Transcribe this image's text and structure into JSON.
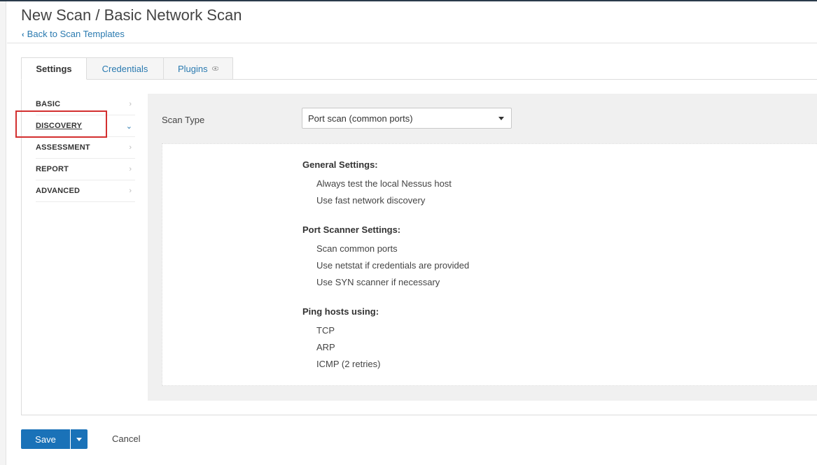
{
  "header": {
    "title": "New Scan / Basic Network Scan",
    "back_link": "Back to Scan Templates"
  },
  "tabs": [
    {
      "label": "Settings",
      "active": true
    },
    {
      "label": "Credentials",
      "active": false
    },
    {
      "label": "Plugins",
      "active": false,
      "icon": "eye-icon"
    }
  ],
  "sidebar": {
    "items": [
      {
        "label": "BASIC",
        "active": false
      },
      {
        "label": "DISCOVERY",
        "active": true
      },
      {
        "label": "ASSESSMENT",
        "active": false
      },
      {
        "label": "REPORT",
        "active": false
      },
      {
        "label": "ADVANCED",
        "active": false
      }
    ]
  },
  "form": {
    "scan_type_label": "Scan Type",
    "scan_type_value": "Port scan (common ports)"
  },
  "summary": {
    "sections": [
      {
        "heading": "General Settings:",
        "items": [
          "Always test the local Nessus host",
          "Use fast network discovery"
        ]
      },
      {
        "heading": "Port Scanner Settings:",
        "items": [
          "Scan common ports",
          "Use netstat if credentials are provided",
          "Use SYN scanner if necessary"
        ]
      },
      {
        "heading": "Ping hosts using:",
        "items": [
          "TCP",
          "ARP",
          "ICMP (2 retries)"
        ]
      }
    ]
  },
  "footer": {
    "save_label": "Save",
    "cancel_label": "Cancel"
  },
  "colors": {
    "accent": "#1a72b8",
    "link": "#2a7ab0",
    "highlight": "#d32f2f"
  }
}
